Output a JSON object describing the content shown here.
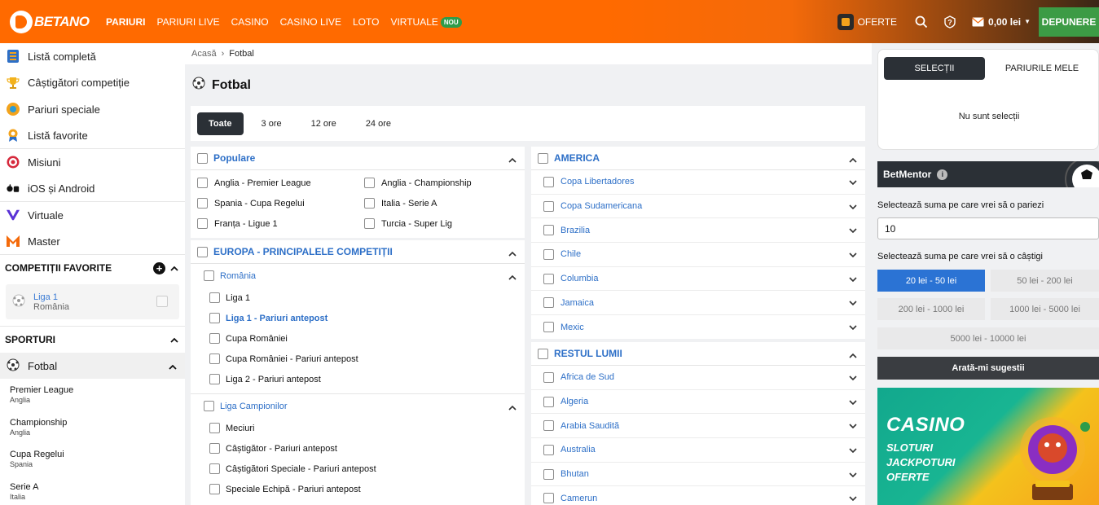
{
  "header": {
    "logo_text": "BETANO",
    "nav": [
      {
        "label": "PARIURI",
        "active": true
      },
      {
        "label": "PARIURI LIVE",
        "active": false
      },
      {
        "label": "CASINO",
        "active": false
      },
      {
        "label": "CASINO LIVE",
        "active": false
      },
      {
        "label": "LOTO",
        "active": false
      },
      {
        "label": "VIRTUALE",
        "active": false
      }
    ],
    "virtual_badge": "NOU",
    "offers_label": "OFERTE",
    "balance": "0,00 lei",
    "deposit_label": "DEPUNERE"
  },
  "sidebar": {
    "items": [
      {
        "label": "Listă completă",
        "icon": "list-icon"
      },
      {
        "label": "Câștigători competiție",
        "icon": "trophy-icon"
      },
      {
        "label": "Pariuri speciale",
        "icon": "special-bets-icon"
      },
      {
        "label": "Listă favorite",
        "icon": "favorites-icon"
      },
      {
        "label": "Misiuni",
        "icon": "target-icon"
      },
      {
        "label": "iOS și Android",
        "icon": "mobile-apps-icon"
      },
      {
        "label": "Virtuale",
        "icon": "virtual-icon"
      },
      {
        "label": "Master",
        "icon": "master-icon"
      }
    ],
    "favorites_title": "COMPETIȚII FAVORITE",
    "favorite": {
      "name": "Liga 1",
      "country": "România"
    },
    "sports_title": "SPORTURI",
    "active_sport": "Fotbal",
    "leagues": [
      {
        "name": "Premier League",
        "country": "Anglia"
      },
      {
        "name": "Championship",
        "country": "Anglia"
      },
      {
        "name": "Cupa Regelui",
        "country": "Spania"
      },
      {
        "name": "Serie A",
        "country": "Italia"
      }
    ]
  },
  "breadcrumb": {
    "home": "Acasă",
    "current": "Fotbal"
  },
  "page_title": "Fotbal",
  "filters": [
    {
      "label": "Toate",
      "active": true
    },
    {
      "label": "3 ore",
      "active": false
    },
    {
      "label": "12 ore",
      "active": false
    },
    {
      "label": "24 ore",
      "active": false
    }
  ],
  "popular": {
    "title": "Populare",
    "items": [
      "Anglia - Premier League",
      "Anglia - Championship",
      "Spania - Cupa Regelui",
      "Italia - Serie A",
      "Franța - Ligue 1",
      "Turcia - Super Lig"
    ]
  },
  "europe": {
    "title": "EUROPA - PRINCIPALELE COMPETIȚII",
    "groups": [
      {
        "name": "România",
        "items": [
          "Liga 1",
          "Liga 1 - Pariuri antepost",
          "Cupa României",
          "Cupa României - Pariuri antepost",
          "Liga 2 - Pariuri antepost"
        ]
      },
      {
        "name": "Liga Campionilor",
        "items": [
          "Meciuri",
          "Câștigător - Pariuri antepost",
          "Câștigători Speciale - Pariuri antepost",
          "Speciale Echipă - Pariuri antepost"
        ]
      }
    ]
  },
  "america": {
    "title": "AMERICA",
    "items": [
      "Copa Libertadores",
      "Copa Sudamericana",
      "Brazilia",
      "Chile",
      "Columbia",
      "Jamaica",
      "Mexic"
    ]
  },
  "rest": {
    "title": "RESTUL LUMII",
    "items": [
      "Africa de Sud",
      "Algeria",
      "Arabia Saudită",
      "Australia",
      "Bhutan",
      "Camerun"
    ]
  },
  "betslip": {
    "tab_selections": "SELECȚII",
    "tab_my_bets": "PARIURILE MELE",
    "empty": "Nu sunt selecții"
  },
  "betmentor": {
    "title": "BetMentor",
    "info": "i",
    "stake_label": "Selectează suma pe care vrei să o pariezi",
    "stake_value": "10",
    "win_label": "Selectează suma pe care vrei să o câștigi",
    "ranges": [
      "20 lei - 50 lei",
      "50 lei - 200 lei",
      "200 lei - 1000 lei",
      "1000 lei - 5000 lei",
      "5000 lei - 10000 lei"
    ],
    "active_range": 0,
    "suggest_label": "Arată-mi sugestii"
  },
  "promo": {
    "title": "CASINO",
    "lines": [
      "SLOTURI",
      "JACKPOTURI",
      "OFERTE"
    ]
  },
  "colors": {
    "brand_orange": "#ff6a00",
    "link_blue": "#2d6fc7",
    "dark": "#2b3036",
    "deposit_green": "#3c9b45",
    "active_range_blue": "#2b73d4"
  }
}
